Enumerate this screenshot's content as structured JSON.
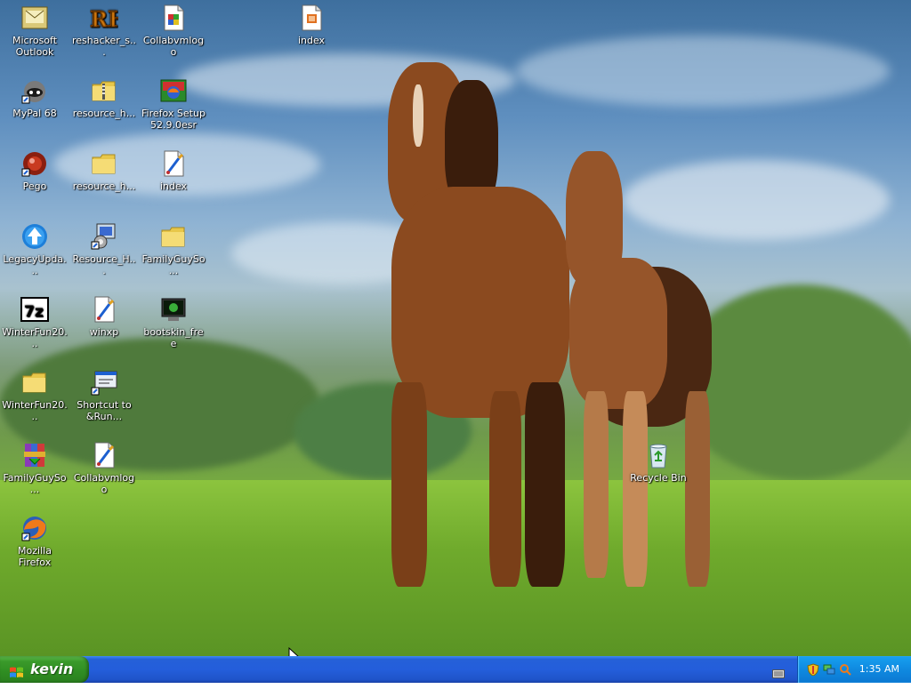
{
  "desktop": {
    "icons": [
      {
        "label": "Microsoft Outlook",
        "icon": "outlook-icon"
      },
      {
        "label": "reshacker_s...",
        "icon": "reshacker-icon"
      },
      {
        "label": "Collabvmlogo",
        "icon": "image-file-icon"
      },
      {
        "label": "index",
        "icon": "html-file-icon"
      },
      {
        "label": "MyPal 68",
        "icon": "mypal-icon"
      },
      {
        "label": "resource_h...",
        "icon": "zip-folder-icon"
      },
      {
        "label": "Firefox Setup 52.9.0esr",
        "icon": "installer-icon"
      },
      {
        "label": "Pego",
        "icon": "pego-icon"
      },
      {
        "label": "resource_h...",
        "icon": "folder-icon"
      },
      {
        "label": "index",
        "icon": "paint-file-icon"
      },
      {
        "label": "LegacyUpda...",
        "icon": "legacy-update-icon"
      },
      {
        "label": "Resource_H...",
        "icon": "resource-hacker-icon"
      },
      {
        "label": "FamilyGuySo...",
        "icon": "folder-icon"
      },
      {
        "label": "WinterFun20...",
        "icon": "7zip-icon"
      },
      {
        "label": "winxp",
        "icon": "paint-file-icon"
      },
      {
        "label": "bootskin_free",
        "icon": "bootskin-icon"
      },
      {
        "label": "WinterFun20...",
        "icon": "folder-icon"
      },
      {
        "label": "Shortcut to &Run...",
        "icon": "run-shortcut-icon"
      },
      {
        "label": "FamilyGuySo...",
        "icon": "winrar-icon"
      },
      {
        "label": "Collabvmlogo",
        "icon": "paint-file-icon"
      },
      {
        "label": "Mozilla Firefox",
        "icon": "firefox-icon"
      },
      {
        "label": "Recycle Bin",
        "icon": "recycle-bin-icon"
      }
    ]
  },
  "taskbar": {
    "start_label": "kevin",
    "clock": "1:35 AM",
    "tray_icons": [
      "security-shield-icon",
      "network-icon",
      "search-icon"
    ],
    "colors": {
      "taskbar": "#245edb",
      "start": "#3a9a2a",
      "tray": "#0f8ae0"
    }
  }
}
